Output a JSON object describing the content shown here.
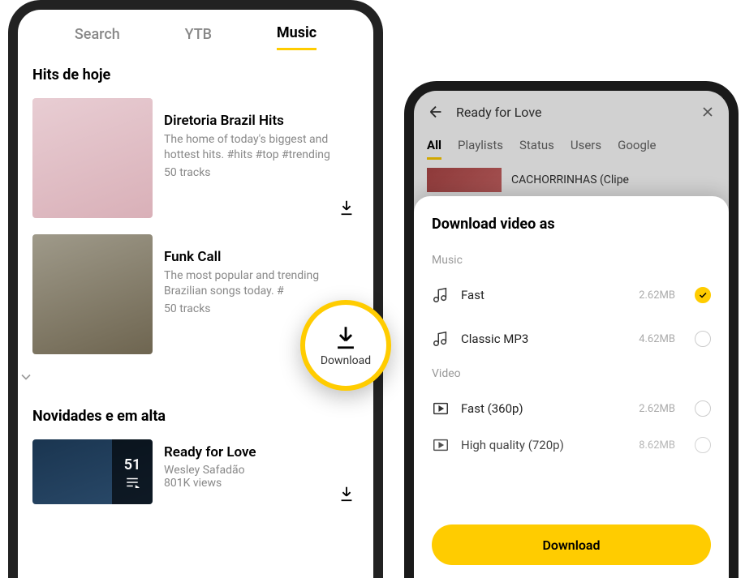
{
  "phone1": {
    "tabs": [
      "Search",
      "YTB",
      "Music"
    ],
    "active_tab": 2,
    "sections": [
      {
        "title": "Hits de hoje",
        "items": [
          {
            "title": "Diretoria Brazil Hits",
            "desc": "The home of today's biggest and hottest hits. #hits #top #trending",
            "meta": "50 tracks"
          },
          {
            "title": "Funk Call",
            "desc": "The most popular and trending Brazilian songs today. #",
            "meta": "50 tracks"
          }
        ]
      },
      {
        "title": "Novidades e em alta",
        "items": [
          {
            "title": "Ready for Love",
            "subtitle": "Wesley Safadão",
            "meta": "801K views",
            "count": "51"
          }
        ]
      }
    ]
  },
  "callout": {
    "label": "Download"
  },
  "phone2": {
    "search_title": "Ready for Love",
    "tabs": [
      "All",
      "Playlists",
      "Status",
      "Users",
      "Google"
    ],
    "active_tab": 0,
    "peek_title": "CACHORRINHAS (Clipe",
    "sheet": {
      "title": "Download video as",
      "groups": [
        {
          "label": "Music",
          "options": [
            {
              "label": "Fast",
              "size": "2.62MB",
              "checked": true,
              "icon": "music"
            },
            {
              "label": "Classic MP3",
              "size": "4.62MB",
              "checked": false,
              "icon": "music"
            }
          ]
        },
        {
          "label": "Video",
          "options": [
            {
              "label": "Fast (360p)",
              "size": "2.62MB",
              "checked": false,
              "icon": "video"
            },
            {
              "label": "High quality (720p)",
              "size": "8.62MB",
              "checked": false,
              "icon": "video"
            }
          ]
        }
      ],
      "button": "Download"
    }
  }
}
